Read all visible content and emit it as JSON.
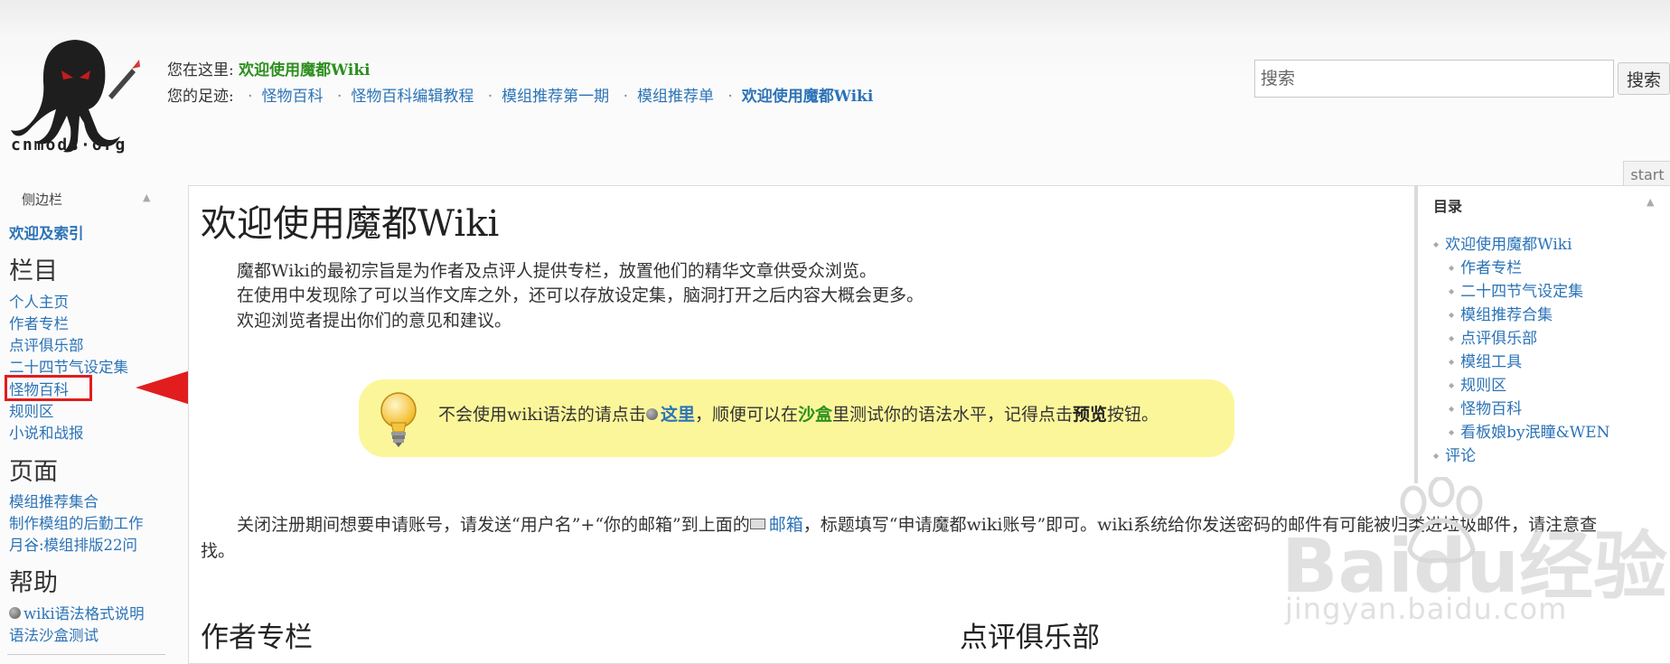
{
  "header": {
    "logo_text": "cnmods·org",
    "trace": {
      "here_label": "您在这里:",
      "here_value": "欢迎使用魔都Wiki",
      "footprint_label": "您的足迹:",
      "separator": "·",
      "crumbs": [
        "怪物百科",
        "怪物百科编辑教程",
        "模组推荐第一期",
        "模组推荐单",
        "欢迎使用魔都Wiki"
      ]
    },
    "search": {
      "placeholder": "搜索",
      "button_label": "搜索"
    }
  },
  "sidebar": {
    "title": "侧边栏",
    "collapse": "▲",
    "welcome": "欢迎及索引",
    "sections": [
      {
        "heading": "栏目",
        "items": [
          "个人主页",
          "作者专栏",
          "点评俱乐部",
          "二十四节气设定集",
          "怪物百科",
          "规则区",
          "小说和战报"
        ]
      },
      {
        "heading": "页面",
        "items": [
          "模组推荐集合",
          "制作模组的后勤工作",
          "月谷:模组排版22问"
        ]
      },
      {
        "heading": "帮助",
        "items": [
          "wiki语法格式说明",
          "语法沙盒测试"
        ]
      }
    ]
  },
  "page": {
    "start_tab": "start",
    "title": "欢迎使用魔都Wiki",
    "intro": [
      "魔都Wiki的最初宗旨是为作者及点评人提供专栏，放置他们的精华文章供受众浏览。",
      "在使用中发现除了可以当作文库之外，还可以存放设定集，脑洞打开之后内容大概会更多。",
      "欢迎浏览者提出你们的意见和建议。"
    ],
    "tip": {
      "pre": "不会使用wiki语法的请点击",
      "here": "这里",
      "mid": "，顺便可以在",
      "sandbox": "沙盒",
      "mid2": "里测试你的语法水平，记得点击",
      "preview": "预览",
      "post": "按钮。"
    },
    "register": {
      "pre": "关闭注册期间想要申请账号，请发送“用户名”+“你的邮箱”到上面的",
      "mail": "邮箱",
      "post": "，标题填写“申请魔都wiki账号”即可。wiki系统给你发送密码的邮件有可能被归类进垃圾邮件，请注意查找。"
    },
    "sections": [
      "作者专栏",
      "点评俱乐部"
    ]
  },
  "toc": {
    "title": "目录",
    "collapse": "▲",
    "items": [
      {
        "label": "欢迎使用魔都Wiki",
        "level": 1
      },
      {
        "label": "作者专栏",
        "level": 2
      },
      {
        "label": "二十四节气设定集",
        "level": 2
      },
      {
        "label": "模组推荐合集",
        "level": 2
      },
      {
        "label": "点评俱乐部",
        "level": 2
      },
      {
        "label": "模组工具",
        "level": 2
      },
      {
        "label": "规则区",
        "level": 2
      },
      {
        "label": "怪物百科",
        "level": 2
      },
      {
        "label": "看板娘by泯瞳&WEN",
        "level": 2
      },
      {
        "label": "评论",
        "level": 1
      }
    ]
  },
  "annotation": {
    "highlighted_item": "怪物百科",
    "color": "#e11d1d"
  },
  "watermark": {
    "logo": "Baidu经验",
    "url": "jingyan.baidu.com"
  }
}
